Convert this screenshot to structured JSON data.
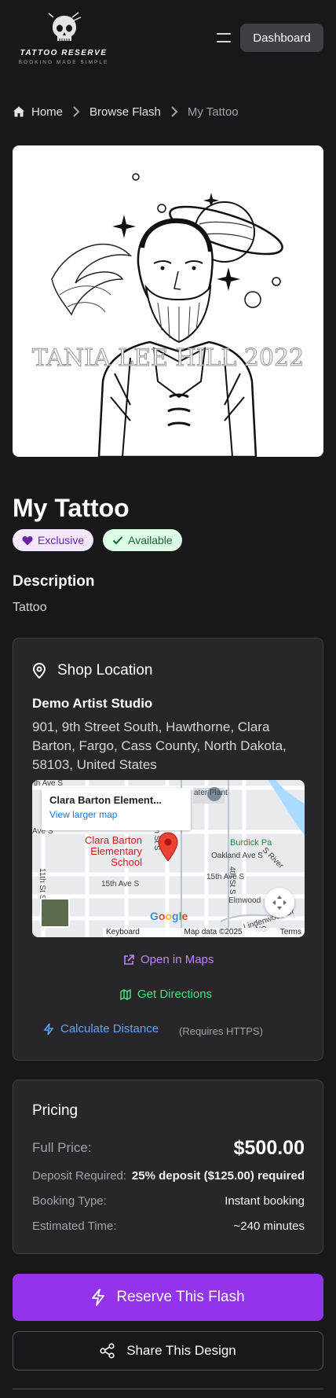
{
  "header": {
    "logo_title": "TATTOO RESERVE",
    "logo_tagline": "BOOKING MADE SIMPLE",
    "menu_icon": "hamburger-icon",
    "dashboard_label": "Dashboard"
  },
  "breadcrumb": {
    "home": "Home",
    "browse": "Browse Flash",
    "current": "My Tattoo"
  },
  "artwork": {
    "watermark": "TANIA LEE HILL 2022"
  },
  "tattoo": {
    "title": "My Tattoo",
    "badge_exclusive": "Exclusive",
    "badge_available": "Available",
    "description_heading": "Description",
    "description": "Tattoo"
  },
  "location": {
    "heading": "Shop Location",
    "studio": "Demo Artist Studio",
    "address": "901, 9th Street South, Hawthorne, Clara Barton, Fargo, Cass County, North Dakota, 58103, United States",
    "map": {
      "info_title": "Clara Barton Element...",
      "info_link": "View larger map",
      "school_label": "Clara Barton Elementary School",
      "streets": {
        "ave_s_top": "th Ave S",
        "ave_s_left": "Ave S",
        "fifteenth_ave": "15th Ave S",
        "fifteenth_ave_right": "15th Ave S",
        "oakland": "Oakland Ave S",
        "elmwood": "Elmwood",
        "lindenwood": "Lindenwood Dr",
        "fifth_st": "5th St S",
        "fourth_st": "4th St S",
        "eleventh_st": "11th St S",
        "burdick": "Burdick Pa",
        "river": "S River",
        "water_plant": "ater Plant",
        "no": "NO"
      },
      "google": "Google",
      "keyboard": "Keyboard shortcuts",
      "map_data": "Map data ©2025 Google",
      "terms": "Terms"
    },
    "open_maps": "Open in Maps",
    "directions": "Get Directions",
    "calc_distance": "Calculate Distance",
    "requires_https": "(Requires HTTPS)"
  },
  "pricing": {
    "heading": "Pricing",
    "full_price_label": "Full Price:",
    "full_price": "$500.00",
    "deposit_label": "Deposit Required:",
    "deposit": "25% deposit ($125.00) required",
    "booking_label": "Booking Type:",
    "booking": "Instant booking",
    "time_label": "Estimated Time:",
    "time": "~240 minutes"
  },
  "actions": {
    "reserve": "Reserve This Flash",
    "share": "Share This Design"
  },
  "colors": {
    "background": "#18181b",
    "card": "#27272a",
    "accent": "#9333ea",
    "maps_link": "#c084fc",
    "directions_link": "#4ade80",
    "distance_link": "#60a5fa"
  }
}
